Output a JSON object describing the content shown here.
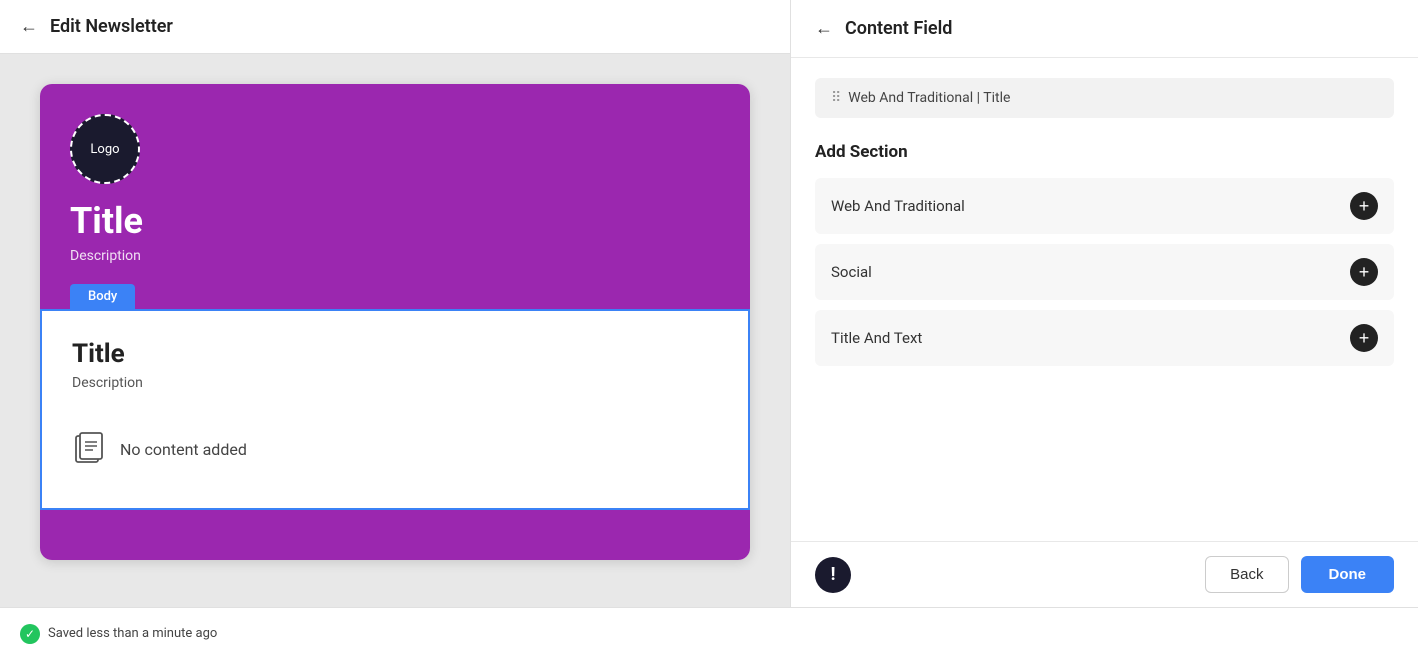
{
  "header": {
    "back_label": "←",
    "title": "Edit Newsletter"
  },
  "newsletter": {
    "logo_text": "Logo",
    "title": "Title",
    "description": "Description",
    "body_tab": "Body",
    "body_title": "Title",
    "body_description": "Description",
    "no_content_text": "No content added"
  },
  "status_bar": {
    "saved_text": "Saved less than a minute ago"
  },
  "right_panel": {
    "title": "Content Field",
    "breadcrumb": "Web And Traditional | Title",
    "add_section_label": "Add Section",
    "sections": [
      {
        "label": "Web And Traditional"
      },
      {
        "label": "Social"
      },
      {
        "label": "Title And Text"
      }
    ],
    "back_button": "Back",
    "done_button": "Done"
  },
  "colors": {
    "purple": "#9b27af",
    "blue": "#3b82f6",
    "dark": "#1a1a2e"
  }
}
